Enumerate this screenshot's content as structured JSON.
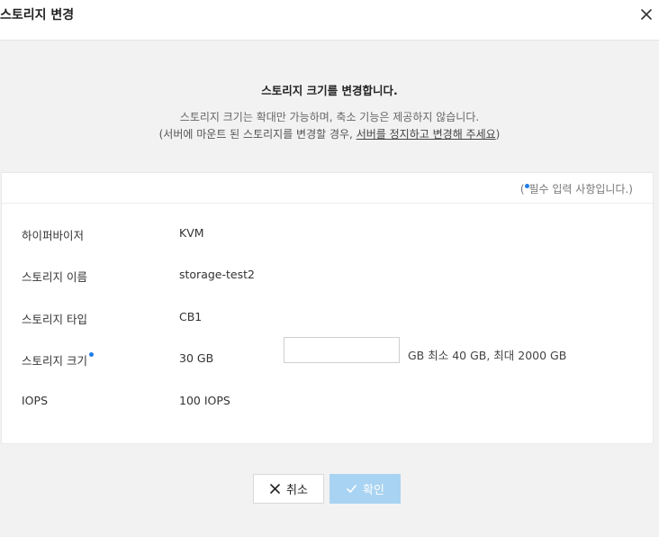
{
  "dialog": {
    "title": "스토리지 변경",
    "close_icon": "close-icon"
  },
  "intro": {
    "heading": "스토리지 크기를 변경합니다.",
    "line1": "스토리지 크기는 확대만 가능하며, 축소 기능은 제공하지 않습니다.",
    "line2_prefix": "(서버에 마운트 된 스토리지를 변경할 경우, ",
    "line2_link": "서버를 정지하고 변경해 주세요",
    "line2_suffix": ")"
  },
  "required_note": {
    "open": "(",
    "text": "필수 입력 사항입니다.)"
  },
  "fields": {
    "hypervisor": {
      "label": "하이퍼바이저",
      "value": "KVM"
    },
    "storage_name": {
      "label": "스토리지 이름",
      "value": "storage-test2"
    },
    "storage_type": {
      "label": "스토리지 타입",
      "value": "CB1"
    },
    "storage_size": {
      "label": "스토리지 크기",
      "value": "30 GB",
      "input_value": "",
      "hint": "GB 최소 40 GB, 최대 2000 GB"
    },
    "iops": {
      "label": "IOPS",
      "value": "100 IOPS"
    }
  },
  "buttons": {
    "cancel": "취소",
    "confirm": "확인"
  },
  "colors": {
    "required_dot": "#1f7ee6",
    "confirm_disabled": "#a9d3f2"
  }
}
